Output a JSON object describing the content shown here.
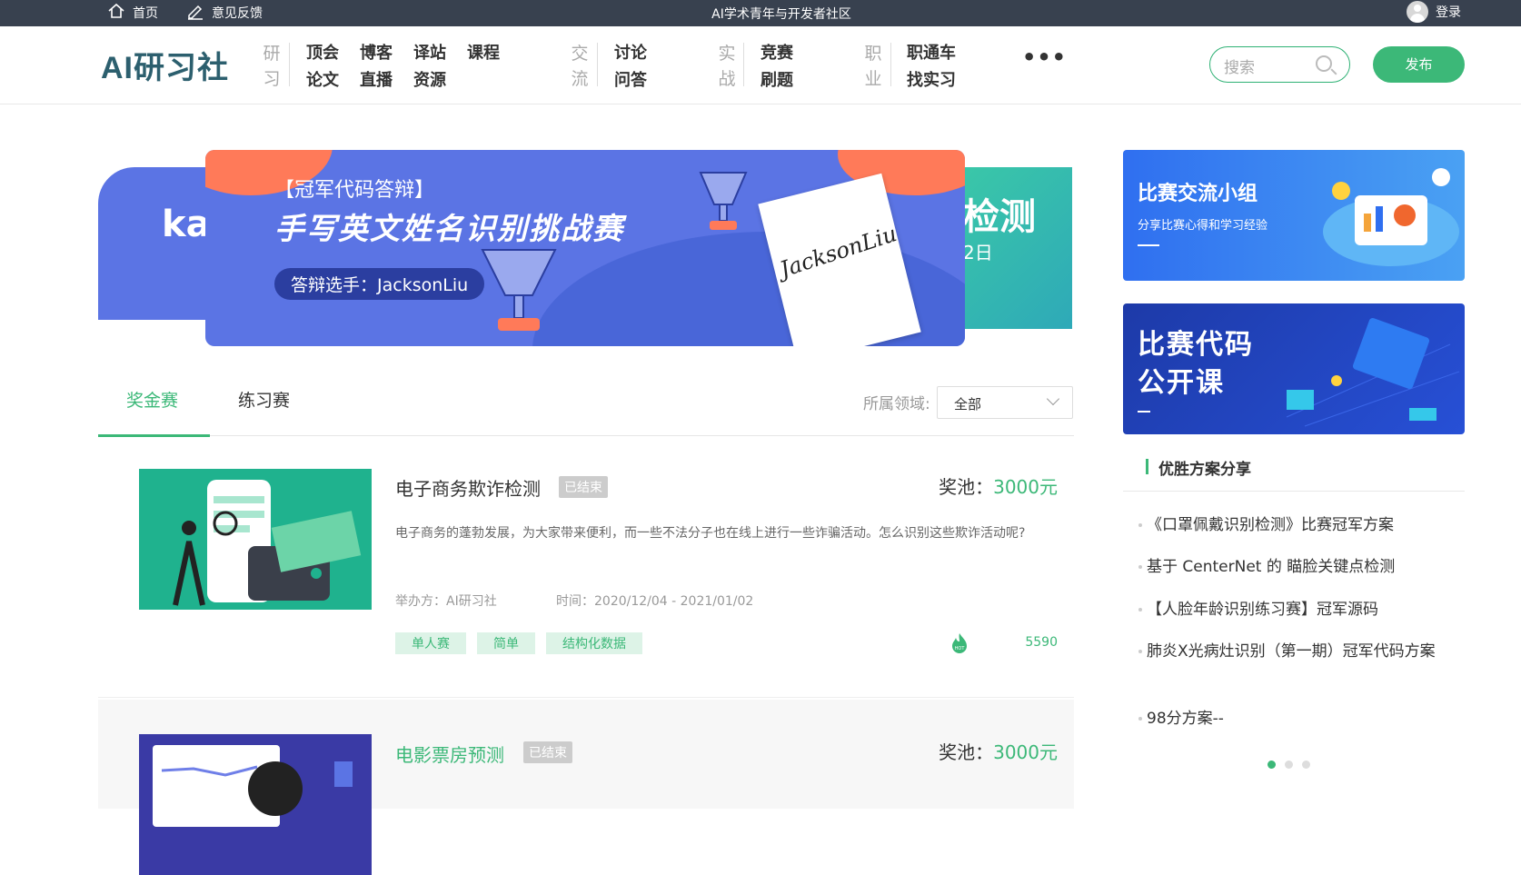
{
  "topbar": {
    "home": "首页",
    "feedback": "意见反馈",
    "center": "AI学术青年与开发者社区",
    "login": "登录"
  },
  "header": {
    "logo": "AI研习社",
    "nav": {
      "cat1": [
        "研",
        "习"
      ],
      "cat1_items": [
        "顶会",
        "博客",
        "译站",
        "课程",
        "论文",
        "直播",
        "资源"
      ],
      "cat2": [
        "交",
        "流"
      ],
      "cat2_items": [
        "讨论",
        "问答"
      ],
      "cat3": [
        "实",
        "战"
      ],
      "cat3_items": [
        "竞赛",
        "刷题"
      ],
      "cat4": [
        "职",
        "业"
      ],
      "cat4_items": [
        "职通车",
        "找实习"
      ],
      "more": "•••"
    },
    "search_placeholder": "搜索",
    "publish": "发布"
  },
  "banner": {
    "tag": "【冠军代码答辩】",
    "title": "手写英文姓名识别挑战赛",
    "pill": "答辩选手：JacksonLiu",
    "signature": "JacksonLiu",
    "left_fragment": "ka",
    "right_fragment": "检测",
    "right_date": "2日"
  },
  "side": {
    "card1_title": "比赛交流小组",
    "card1_sub": "分享比赛心得和学习经验",
    "card2_title_1": "比赛代码",
    "card2_title_2": "公开课"
  },
  "tabs": {
    "bonus": "奖金赛",
    "practice": "练习赛",
    "filter_label": "所属领域:",
    "filter_value": "全部"
  },
  "competitions": [
    {
      "name": "电子商务欺诈检测",
      "status": "已结束",
      "prize_label": "奖池：",
      "prize": "3000元",
      "desc": "电子商务的蓬勃发展，为大家带来便利，而一些不法分子也在线上进行一些诈骗活动。怎么识别这些欺诈活动呢?",
      "host": "举办方：AI研习社",
      "time": "时间：2020/12/04 - 2021/01/02",
      "tags": [
        "单人赛",
        "简单",
        "结构化数据"
      ],
      "hot": "5590"
    },
    {
      "name": "电影票房预测",
      "status": "已结束",
      "prize_label": "奖池：",
      "prize": "3000元"
    }
  ],
  "share": {
    "title": "优胜方案分享",
    "items": [
      "《口罩佩戴识别检测》比赛冠军方案",
      "基于 CenterNet 的 瞄脸关键点检测",
      "【人脸年龄识别练习赛】冠军源码",
      "肺炎X光病灶识别（第一期）冠军代码方案",
      "98分方案--"
    ]
  },
  "colors": {
    "accent": "#3cb878",
    "topbar": "#38414f",
    "banner": "#5b74e4"
  }
}
